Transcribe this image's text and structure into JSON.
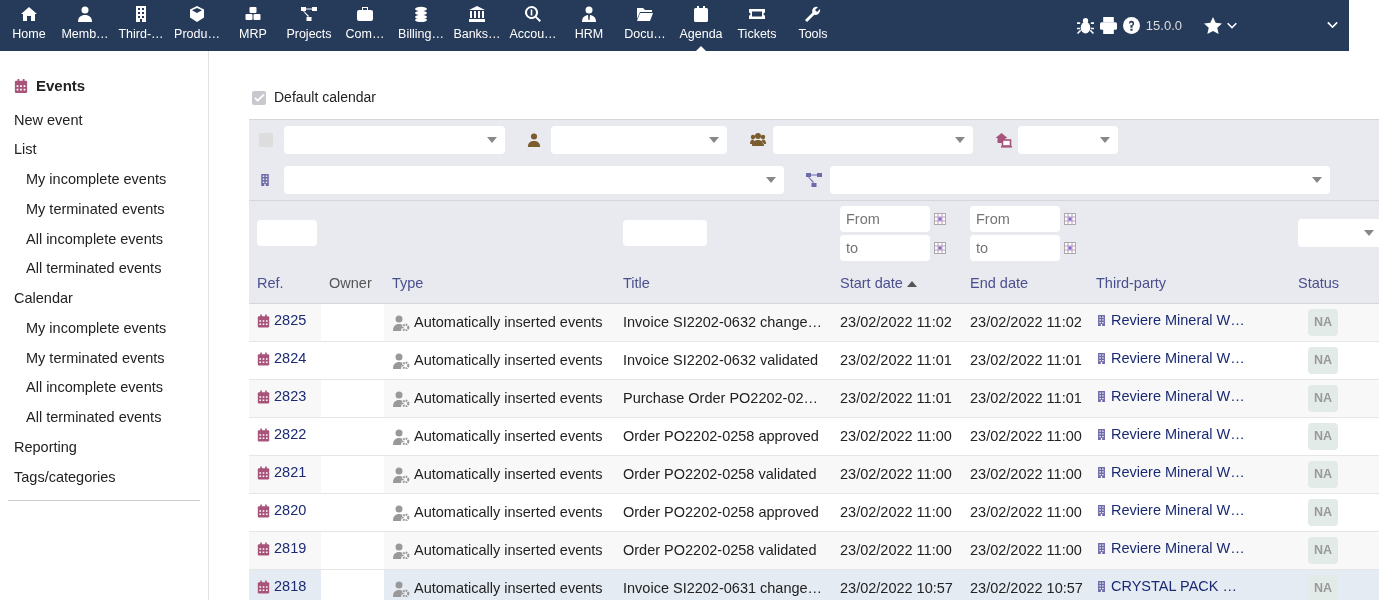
{
  "topbar": {
    "menu": [
      {
        "label": "Home",
        "selected": false
      },
      {
        "label": "Memb…",
        "selected": false
      },
      {
        "label": "Third-…",
        "selected": false
      },
      {
        "label": "Produ…",
        "selected": false
      },
      {
        "label": "MRP",
        "selected": false
      },
      {
        "label": "Projects",
        "selected": false
      },
      {
        "label": "Com…",
        "selected": false
      },
      {
        "label": "Billing…",
        "selected": false
      },
      {
        "label": "Banks…",
        "selected": false
      },
      {
        "label": "Accou…",
        "selected": false
      },
      {
        "label": "HRM",
        "selected": false
      },
      {
        "label": "Docu…",
        "selected": false
      },
      {
        "label": "Agenda",
        "selected": true
      },
      {
        "label": "Tickets",
        "selected": false
      },
      {
        "label": "Tools",
        "selected": false
      }
    ],
    "version": "15.0.0"
  },
  "sidebar": {
    "title": "Events",
    "items": [
      {
        "label": "New event"
      },
      {
        "label": "List",
        "children": [
          {
            "label": "My incomplete events"
          },
          {
            "label": "My terminated events"
          },
          {
            "label": "All incomplete events"
          },
          {
            "label": "All terminated events"
          }
        ]
      },
      {
        "label": "Calendar",
        "children": [
          {
            "label": "My incomplete events"
          },
          {
            "label": "My terminated events"
          },
          {
            "label": "All incomplete events"
          },
          {
            "label": "All terminated events"
          }
        ]
      },
      {
        "label": "Reporting"
      },
      {
        "label": "Tags/categories"
      }
    ]
  },
  "default_calendar": {
    "label": "Default calendar",
    "checked": true
  },
  "filters": {
    "first_checkbox_checked": false
  },
  "table": {
    "columns": [
      {
        "label": "Ref."
      },
      {
        "label": "Owner"
      },
      {
        "label": "Type"
      },
      {
        "label": "Title"
      },
      {
        "label": "Start date",
        "sorted_ascending": true
      },
      {
        "label": "End date"
      },
      {
        "label": "Third-party"
      },
      {
        "label": "Status"
      }
    ],
    "filter_row": [
      {
        "kind": "text"
      },
      {
        "kind": "blank"
      },
      {
        "kind": "blank"
      },
      {
        "kind": "text"
      },
      {
        "kind": "daterange",
        "from_placeholder": "From",
        "to_placeholder": "to"
      },
      {
        "kind": "daterange",
        "from_placeholder": "From",
        "to_placeholder": "to"
      },
      {
        "kind": "blank"
      },
      {
        "kind": "select"
      }
    ],
    "rows": [
      {
        "ref": "2825",
        "type": "Automatically inserted events",
        "title": "Invoice SI2202-0632 change…",
        "start": "23/02/2022 11:02",
        "end": "23/02/2022 11:02",
        "third_party": "Reviere Mineral W…",
        "status": "NA",
        "selected": false
      },
      {
        "ref": "2824",
        "type": "Automatically inserted events",
        "title": "Invoice SI2202-0632 validated",
        "start": "23/02/2022 11:01",
        "end": "23/02/2022 11:01",
        "third_party": "Reviere Mineral W…",
        "status": "NA",
        "selected": false
      },
      {
        "ref": "2823",
        "type": "Automatically inserted events",
        "title": "Purchase Order PO2202-02…",
        "start": "23/02/2022 11:01",
        "end": "23/02/2022 11:01",
        "third_party": "Reviere Mineral W…",
        "status": "NA",
        "selected": false
      },
      {
        "ref": "2822",
        "type": "Automatically inserted events",
        "title": "Order PO2202-0258 approved",
        "start": "23/02/2022 11:00",
        "end": "23/02/2022 11:00",
        "third_party": "Reviere Mineral W…",
        "status": "NA",
        "selected": false
      },
      {
        "ref": "2821",
        "type": "Automatically inserted events",
        "title": "Order PO2202-0258 validated",
        "start": "23/02/2022 11:00",
        "end": "23/02/2022 11:00",
        "third_party": "Reviere Mineral W…",
        "status": "NA",
        "selected": false
      },
      {
        "ref": "2820",
        "type": "Automatically inserted events",
        "title": "Order PO2202-0258 approved",
        "start": "23/02/2022 11:00",
        "end": "23/02/2022 11:00",
        "third_party": "Reviere Mineral W…",
        "status": "NA",
        "selected": false
      },
      {
        "ref": "2819",
        "type": "Automatically inserted events",
        "title": "Order PO2202-0258 validated",
        "start": "23/02/2022 11:00",
        "end": "23/02/2022 11:00",
        "third_party": "Reviere Mineral W…",
        "status": "NA",
        "selected": false
      },
      {
        "ref": "2818",
        "type": "Automatically inserted events",
        "title": "Invoice SI2202-0631 change…",
        "start": "23/02/2022 10:57",
        "end": "23/02/2022 10:57",
        "third_party": "CRYSTAL PACK …",
        "status": "NA",
        "selected": true
      }
    ]
  }
}
